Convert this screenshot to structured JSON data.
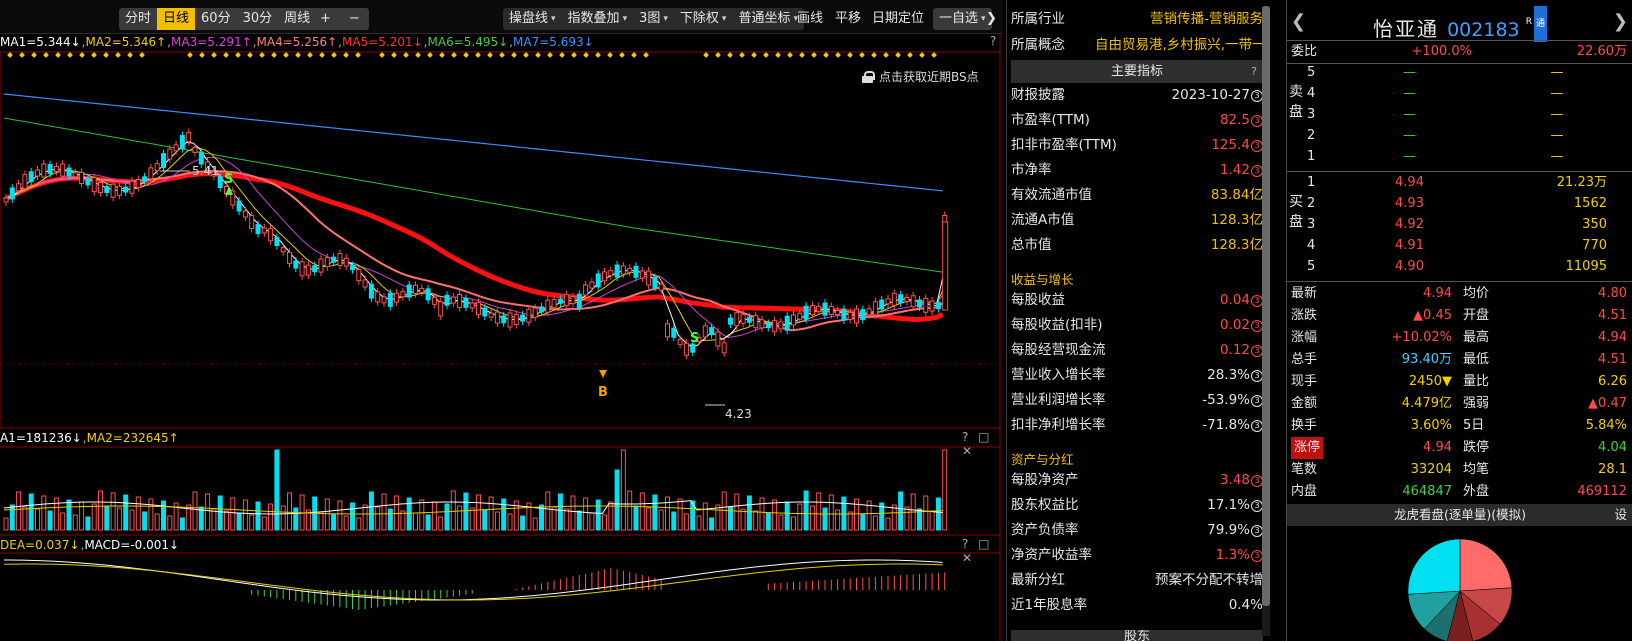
{
  "toolbar": {
    "periods": [
      "分时",
      "日线",
      "60分",
      "30分"
    ],
    "active_period": "日线",
    "week": "周线",
    "plus": "+",
    "minus": "−",
    "disk_line": "操盘线",
    "index_overlay": "指数叠加",
    "three_charts": "3图",
    "rights": "下除权",
    "coord": "普通坐标",
    "draw": "画线",
    "pan": "平移",
    "date_locate": "日期定位",
    "watch": "一自选",
    "more": "❯"
  },
  "ma_legend": [
    {
      "text": "MA1=5.344↓",
      "color": "#ffffff"
    },
    {
      "text": "MA2=5.346↑",
      "color": "#f0d000"
    },
    {
      "text": "MA3=5.291↑",
      "color": "#e040e0"
    },
    {
      "text": "MA4=5.256↑",
      "color": "#ff8080"
    },
    {
      "text": "MA5=5.201↓",
      "color": "#ff3030"
    },
    {
      "text": "MA6=5.495↓",
      "color": "#40d040"
    },
    {
      "text": "MA7=5.693↓",
      "color": "#4090ff"
    }
  ],
  "bs_hint": "点击获取近期BS点",
  "chart_annotations": {
    "high": "5.41",
    "low": "4.23",
    "s_mark": "S",
    "b_mark": "B"
  },
  "vol_legend": [
    {
      "text": "A1=181236↓",
      "color": "#ffffff"
    },
    {
      "text": "MA2=232645↑",
      "color": "#f0d000"
    }
  ],
  "macd_legend": [
    {
      "text": "DEA=0.037↓",
      "color": "#f0d000"
    },
    {
      "text": "MACD=-0.001↓",
      "color": "#ffffff"
    }
  ],
  "panel_controls": "? □ ✕",
  "chart_data": {
    "type": "candlestick",
    "title": "",
    "ylabel": "",
    "price_range": [
      4.23,
      5.41
    ],
    "annotated_high": 5.41,
    "annotated_low": 4.23,
    "last_close": 4.94,
    "series": [
      {
        "name": "MA1",
        "last": 5.344
      },
      {
        "name": "MA2",
        "last": 5.346
      },
      {
        "name": "MA3",
        "last": 5.291
      },
      {
        "name": "MA4",
        "last": 5.256
      },
      {
        "name": "MA5",
        "last": 5.201
      },
      {
        "name": "MA6",
        "last": 5.495
      },
      {
        "name": "MA7",
        "last": 5.693
      }
    ],
    "volume": {
      "MA1": 181236,
      "MA2": 232645
    },
    "macd": {
      "DEA": 0.037,
      "MACD": -0.001
    },
    "grid": false
  },
  "info": {
    "industry_label": "所属行业",
    "industry_value": "营销传播-营销服务",
    "concept_label": "所属概念",
    "concept_value": "自由贸易港,乡村振兴,一带一...",
    "main_header": "主要指标",
    "q": "?",
    "rows": [
      {
        "label": "财报披露",
        "value": "2023-10-27",
        "cls": "wht",
        "badge": "3"
      },
      {
        "label": "市盈率(TTM)",
        "value": "82.5",
        "cls": "red",
        "badge": "3"
      },
      {
        "label": "扣非市盈率(TTM)",
        "value": "125.4",
        "cls": "red",
        "badge": "3"
      },
      {
        "label": "市净率",
        "value": "1.42",
        "cls": "red",
        "badge": "3"
      },
      {
        "label": "有效流通市值",
        "value": "83.84亿",
        "cls": "yel",
        "badge": ""
      },
      {
        "label": "流通A市值",
        "value": "128.3亿",
        "cls": "yel",
        "badge": ""
      },
      {
        "label": "总市值",
        "value": "128.3亿",
        "cls": "yel",
        "badge": ""
      }
    ],
    "growth_title": "收益与增长",
    "growth_rows": [
      {
        "label": "每股收益",
        "value": "0.04",
        "cls": "red",
        "badge": "3"
      },
      {
        "label": "每股收益(扣非)",
        "value": "0.02",
        "cls": "red",
        "badge": "3"
      },
      {
        "label": "每股经营现金流",
        "value": "0.12",
        "cls": "red",
        "badge": "3"
      },
      {
        "label": "营业收入增长率",
        "value": "28.3%",
        "cls": "wht",
        "badge": "3"
      },
      {
        "label": "营业利润增长率",
        "value": "-53.9%",
        "cls": "wht",
        "badge": "3"
      },
      {
        "label": "扣非净利增长率",
        "value": "-71.8%",
        "cls": "wht",
        "badge": "3"
      }
    ],
    "asset_title": "资产与分红",
    "asset_rows": [
      {
        "label": "每股净资产",
        "value": "3.48",
        "cls": "red",
        "badge": "3"
      },
      {
        "label": "股东权益比",
        "value": "17.1%",
        "cls": "wht",
        "badge": "3"
      },
      {
        "label": "资产负债率",
        "value": "79.9%",
        "cls": "wht",
        "badge": "3"
      },
      {
        "label": "净资产收益率",
        "value": "1.3%",
        "cls": "red",
        "badge": "3"
      },
      {
        "label": "最新分红",
        "value": "预案不分配不转增",
        "cls": "wht",
        "badge": ""
      },
      {
        "label": "近1年股息率",
        "value": "0.4%",
        "cls": "wht",
        "badge": ""
      }
    ],
    "bottom_header": "股东"
  },
  "quote": {
    "name": "怡亚通",
    "code": "002183",
    "badge_r": "R",
    "badge_t": "通",
    "wei_label": "委比",
    "wei_pct": "+100.0%",
    "wei_diff": "22.60万",
    "sell_side": "卖盘",
    "buy_side": "买盘",
    "sells": [
      {
        "lvl": "5",
        "price": "—",
        "vol": "—"
      },
      {
        "lvl": "4",
        "price": "—",
        "vol": "—"
      },
      {
        "lvl": "3",
        "price": "—",
        "vol": "—"
      },
      {
        "lvl": "2",
        "price": "—",
        "vol": "—"
      },
      {
        "lvl": "1",
        "price": "—",
        "vol": "—"
      }
    ],
    "buys": [
      {
        "lvl": "1",
        "price": "4.94",
        "vol": "21.23万"
      },
      {
        "lvl": "2",
        "price": "4.93",
        "vol": "1562"
      },
      {
        "lvl": "3",
        "price": "4.92",
        "vol": "350"
      },
      {
        "lvl": "4",
        "price": "4.91",
        "vol": "770"
      },
      {
        "lvl": "5",
        "price": "4.90",
        "vol": "11095"
      }
    ],
    "stats": [
      {
        "l1": "最新",
        "v1": "4.94",
        "c1": "#ff4a4a",
        "l2": "均价",
        "v2": "4.80",
        "c2": "#ff4a4a"
      },
      {
        "l1": "涨跌",
        "v1": "▲0.45",
        "c1": "#ff4a4a",
        "l2": "开盘",
        "v2": "4.51",
        "c2": "#ff4a4a"
      },
      {
        "l1": "涨幅",
        "v1": "+10.02%",
        "c1": "#ff4a4a",
        "l2": "最高",
        "v2": "4.94",
        "c2": "#ff4a4a"
      },
      {
        "l1": "总手",
        "v1": "93.40万",
        "c1": "#3fd0ff",
        "l2": "最低",
        "v2": "4.51",
        "c2": "#ff4a4a"
      },
      {
        "l1": "现手",
        "v1": "2450▼",
        "c1": "#f0d000",
        "l2": "量比",
        "v2": "6.26",
        "c2": "#f0d000"
      },
      {
        "l1": "金额",
        "v1": "4.479亿",
        "c1": "#f0d000",
        "l2": "强弱",
        "v2": "▲0.47",
        "c2": "#ff4a4a"
      },
      {
        "l1": "换手",
        "v1": "3.60%",
        "c1": "#f0d000",
        "l2": "5日",
        "v2": "5.84%",
        "c2": "#f0d000"
      },
      {
        "l1": "涨停",
        "v1": "4.94",
        "c1": "#ff4a4a",
        "l2": "跌停",
        "v2": "4.04",
        "c2": "#40d040"
      },
      {
        "l1": "笔数",
        "v1": "33204",
        "c1": "#f0d000",
        "l2": "均笔",
        "v2": "28.1",
        "c2": "#f0d000"
      },
      {
        "l1": "内盘",
        "v1": "464847",
        "c1": "#40d040",
        "l2": "外盘",
        "v2": "469112",
        "c2": "#ff4a4a"
      }
    ],
    "lh_title": "龙虎看盘(逐单量)(模拟)",
    "lh_set": "设",
    "pie": [
      {
        "value": 24,
        "color": "#ff6a6a"
      },
      {
        "value": 12,
        "color": "#c84848"
      },
      {
        "value": 10,
        "color": "#a83030"
      },
      {
        "value": 8,
        "color": "#7a2020"
      },
      {
        "value": 8,
        "color": "#1e7070"
      },
      {
        "value": 12,
        "color": "#20a0a0"
      },
      {
        "value": 26,
        "color": "#00e0f0"
      }
    ]
  }
}
